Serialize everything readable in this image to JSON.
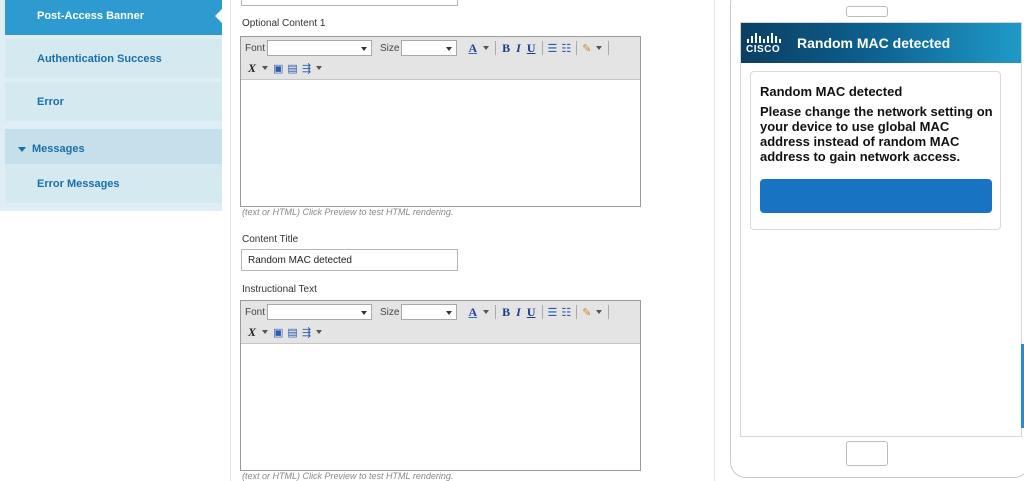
{
  "sidebar": {
    "items": [
      {
        "label": "Post-Access Banner"
      },
      {
        "label": "Authentication Success"
      },
      {
        "label": "Error"
      },
      {
        "label": "Messages"
      },
      {
        "label": "Error Messages"
      }
    ]
  },
  "optional_content_1": {
    "label": "Optional Content 1",
    "hint": "(text or HTML) Click Preview to test HTML rendering."
  },
  "content_title": {
    "label": "Content Title",
    "value": "Random MAC detected"
  },
  "instructional_text": {
    "label": "Instructional Text",
    "hint": "(text or HTML) Click Preview to test HTML rendering."
  },
  "toolbar": {
    "font_label": "Font",
    "size_label": "Size"
  },
  "preview": {
    "logo_text": "CISCO",
    "banner_title": "Random MAC detected",
    "card_title": "Random MAC detected",
    "card_body": "Please change the network setting on your device to use global MAC address instead of random MAC address to gain network access."
  },
  "colors": {
    "accent": "#2d9bd0",
    "nav_text": "#1a6fa8",
    "button": "#1873c3"
  }
}
